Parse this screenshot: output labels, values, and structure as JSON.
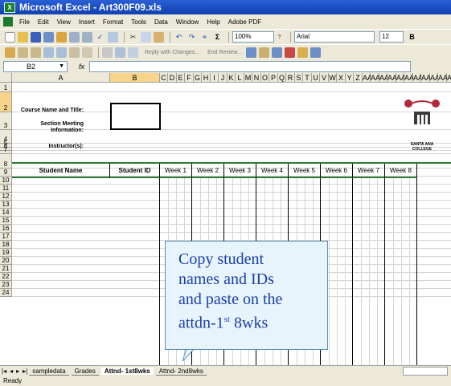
{
  "window": {
    "title": "Microsoft Excel - Art300F09.xls"
  },
  "menu": [
    "File",
    "Edit",
    "View",
    "Insert",
    "Format",
    "Tools",
    "Data",
    "Window",
    "Help",
    "Adobe PDF"
  ],
  "toolbar": {
    "zoom": "100%",
    "font": "Arial",
    "size": "12",
    "reply_text": "Reply with Changes...",
    "end_review": "End Review..."
  },
  "formula": {
    "name_box": "B2",
    "fx": "fx",
    "content": ""
  },
  "columns": [
    "A",
    "B",
    "C",
    "D",
    "E",
    "F",
    "G",
    "H",
    "I",
    "J",
    "K",
    "L",
    "M",
    "N",
    "O",
    "P",
    "Q",
    "R",
    "S",
    "T",
    "U",
    "V",
    "W",
    "X",
    "Y",
    "Z",
    "AA",
    "AA",
    "AA",
    "AA",
    "AA",
    "AA",
    "AA",
    "AA",
    "AA",
    "AA",
    "AA",
    "AE"
  ],
  "sheet": {
    "course_label": "Course Name and Title:",
    "section_label": "Section Meeting Information:",
    "instructor_label": "Instructor(s):",
    "col_student_name": "Student Name",
    "col_student_id": "Student ID",
    "weeks": [
      "Week 1",
      "Week 2",
      "Week 3",
      "Week 4",
      "Week 5",
      "Week 6",
      "Week 7",
      "Week 8"
    ]
  },
  "rows": [
    "1",
    "2",
    "3",
    "4",
    "5",
    "6",
    "7",
    "8",
    "9",
    "10",
    "11",
    "12",
    "13",
    "14",
    "15",
    "16",
    "17",
    "18",
    "19",
    "20",
    "21",
    "22",
    "23",
    "24"
  ],
  "logo": {
    "line1": "SANTA ANA",
    "line2": "COLLEGE"
  },
  "callout": {
    "line1": "Copy student",
    "line2": "names and IDs",
    "line3": "and paste on the",
    "line4_pre": "attdn-1",
    "line4_sup": "st",
    "line4_post": " 8wks"
  },
  "tabs": [
    "sampledata",
    "Grades",
    "Attnd- 1st8wks",
    "Attnd- 2nd8wks"
  ],
  "active_tab": "Attnd- 1st8wks",
  "status": "Ready"
}
